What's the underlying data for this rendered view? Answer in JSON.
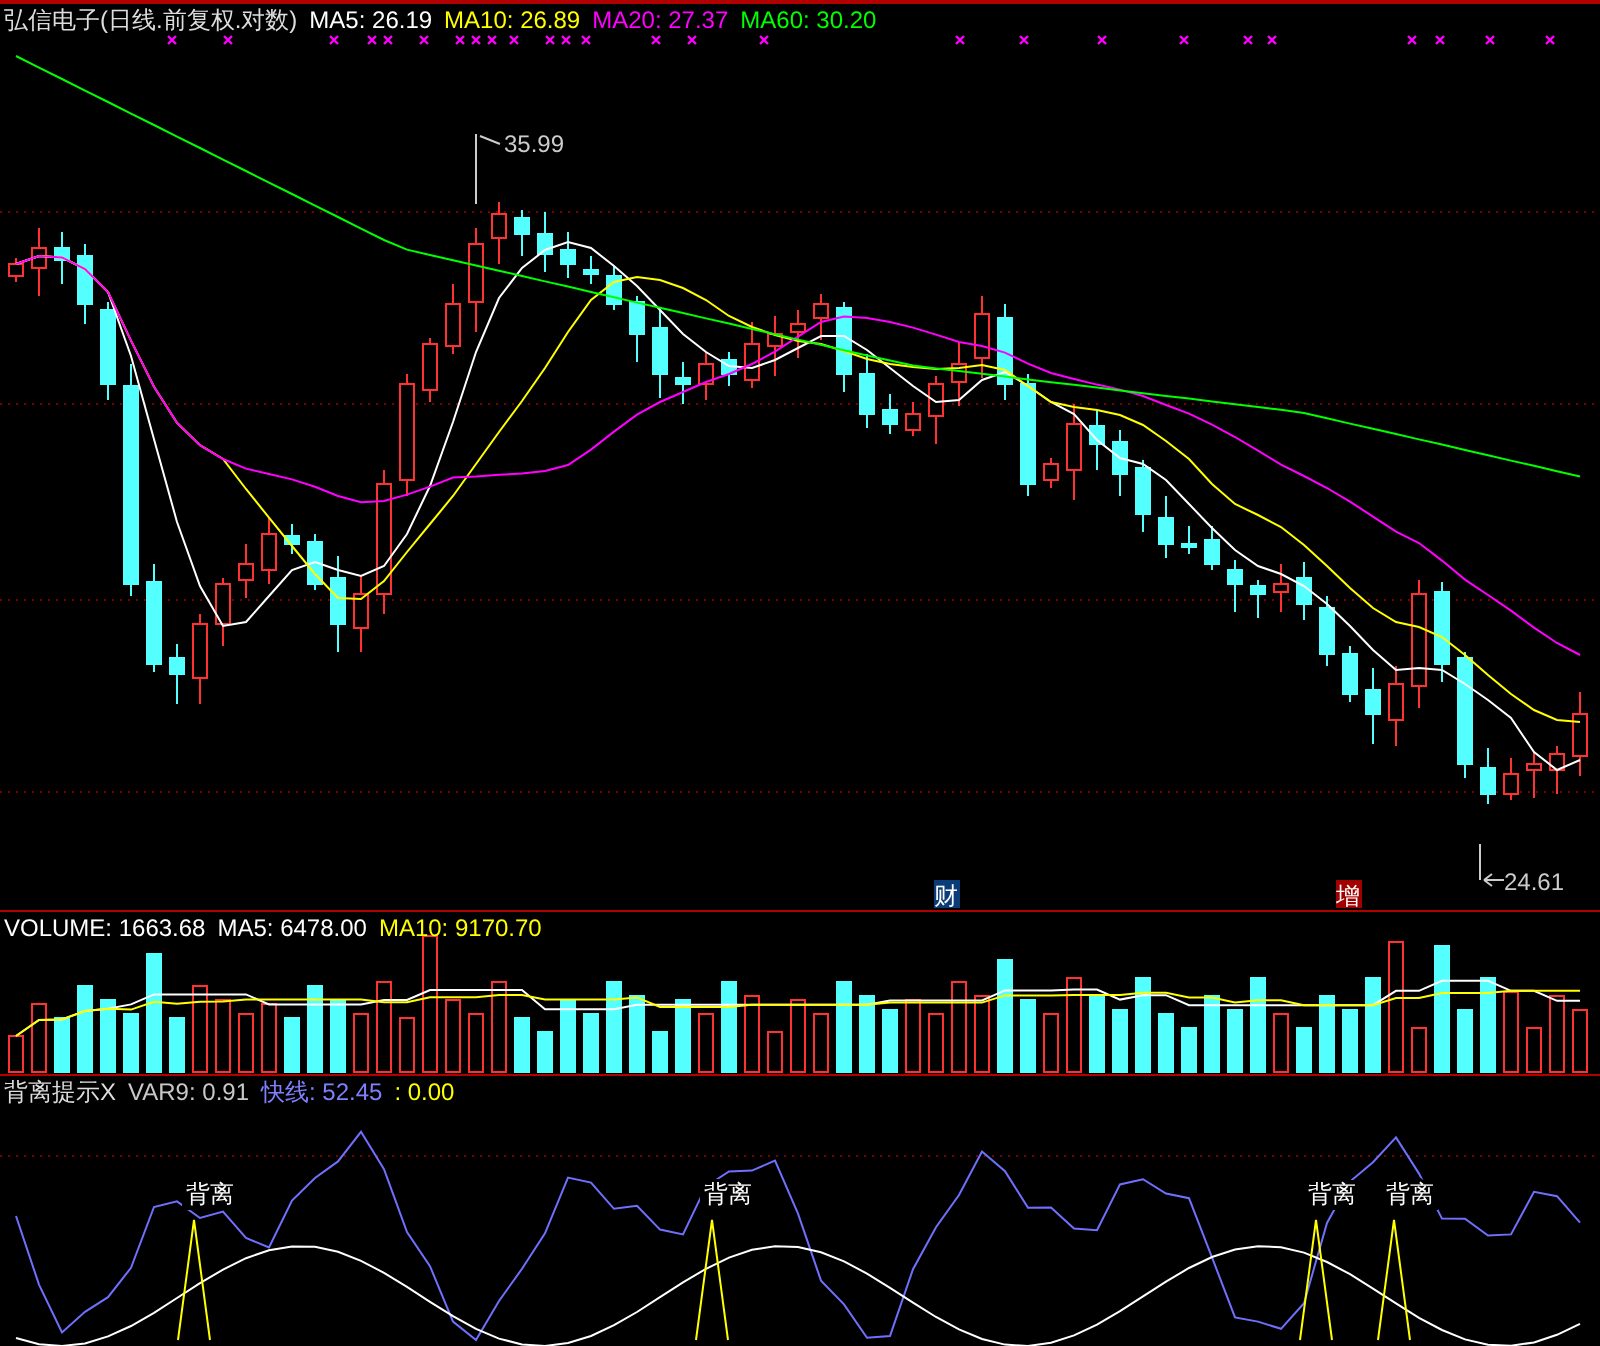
{
  "price_panel": {
    "title": "弘信电子(日线.前复权.对数)",
    "indicators": [
      {
        "label": "MA5: 26.19",
        "color": "#ffffff"
      },
      {
        "label": "MA10: 26.89",
        "color": "#ffff00"
      },
      {
        "label": "MA20: 27.37",
        "color": "#ff00ff"
      },
      {
        "label": "MA60: 30.20",
        "color": "#00ff00"
      }
    ],
    "high_label": "35.99",
    "low_label": "24.61",
    "event_badges": [
      {
        "text": "财",
        "color": "#0a3c78"
      },
      {
        "text": "增",
        "color": "#a00000"
      }
    ]
  },
  "volume_panel": {
    "indicators": [
      {
        "label": "VOLUME: 1663.68",
        "color": "#ffffff"
      },
      {
        "label": "MA5: 6478.00",
        "color": "#ffffff"
      },
      {
        "label": "MA10: 9170.70",
        "color": "#ffff00"
      }
    ]
  },
  "signal_panel": {
    "title": "背离提示X",
    "indicators": [
      {
        "label": "VAR9: 0.91",
        "color": "#c8c8c8"
      },
      {
        "label": "快线: 52.45",
        "color": "#8080ff"
      },
      {
        "label": ": 0.00",
        "color": "#ffff00"
      }
    ],
    "divergence_labels": [
      "背离",
      "背离",
      "背离",
      "背离"
    ]
  }
}
